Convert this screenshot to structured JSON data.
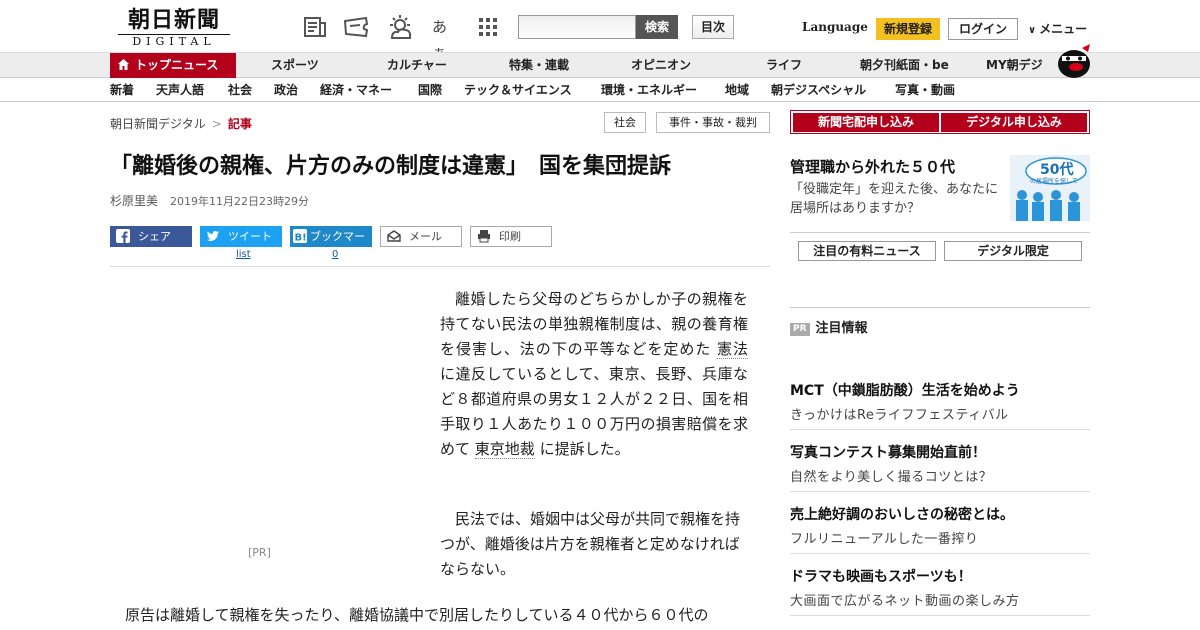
{
  "header": {
    "logo_jp": "朝日新聞",
    "logo_en": "DIGITAL",
    "kana_icon": "あぁ",
    "search_label": "検索",
    "toc_label": "目次",
    "language_label": "Language",
    "register_label": "新規登録",
    "login_label": "ログイン",
    "menu_label": "メニュー"
  },
  "nav_primary": [
    "トップニュース",
    "スポーツ",
    "カルチャー",
    "特集・連載",
    "オピニオン",
    "ライフ",
    "朝夕刊紙面・be",
    "MY朝デジ"
  ],
  "nav_secondary": [
    "新着",
    "天声人語",
    "社会",
    "政治",
    "経済・マネー",
    "国際",
    "テック＆サイエンス",
    "環境・エネルギー",
    "地域",
    "朝デジスペシャル",
    "写真・動画"
  ],
  "breadcrumb": {
    "home": "朝日新聞デジタル",
    "sep": ">",
    "current": "記事"
  },
  "tags": [
    "社会",
    "事件・事故・裁判"
  ],
  "article": {
    "title": "「離婚後の親権、片方のみの制度は違憲」　国を集団提訴",
    "author": "杉原里美",
    "date": "2019年11月22日23時29分",
    "share": {
      "facebook": "シェア",
      "twitter": "ツイート",
      "twitter_count": "list",
      "hatena": "ブックマーク",
      "hatena_count": "0",
      "mail": "メール",
      "print": "印刷"
    },
    "ad_pr": "[PR]",
    "p1_a": "離婚したら父母のどちらかしか子の親権を持てない民法の単独親権制度は、親の養育権を侵害し、法の下の平等などを定めた",
    "p1_link1": "憲法",
    "p1_b": "に違反しているとして、東京、長野、兵庫など８都道府県の男女１２人が２２日、国を相手取り１人あたり１００万円の損害賠償を求めて",
    "p1_link2": "東京地裁",
    "p1_c": "に提訴した。",
    "p2": "民法では、婚姻中は父母が共同で親権を持つが、離婚後は片方を親権者と定めなければならない。",
    "p3": "原告は離婚して親権を失ったり、離婚協議中で別居したりしている４０代から６０代の"
  },
  "sidebar": {
    "subscribe_paper": "新聞宅配申し込み",
    "subscribe_digital": "デジタル申し込み",
    "promo_title": "管理職から外れた５０代",
    "promo_text": "「役職定年」を迎えた後、あなたに居場所はありますか？",
    "promo_img_text": "50代",
    "promo_img_sub": "の居場所を探して",
    "tab_paid": "注目の有料ニュース",
    "tab_digital": "デジタル限定",
    "pr_badge": "PR",
    "pr_heading": "注目情報",
    "pr_items": [
      {
        "title": "MCT（中鎖脂肪酸）生活を始めよう",
        "sub": "きっかけはReライフフェスティバル"
      },
      {
        "title": "写真コンテスト募集開始直前！",
        "sub": "自然をより美しく撮るコツとは？"
      },
      {
        "title": "売上絶好調のおいしさの秘密とは。",
        "sub": "フルリニューアルした一番搾り"
      },
      {
        "title": "ドラマも映画もスポーツも！",
        "sub": "大画面で広がるネット動画の楽しみ方"
      }
    ]
  },
  "colors": {
    "brand_red": "#b3001b",
    "register_yellow": "#f3c020",
    "facebook": "#3b5998",
    "twitter": "#1da1f2",
    "hatena": "#1e88c9"
  }
}
